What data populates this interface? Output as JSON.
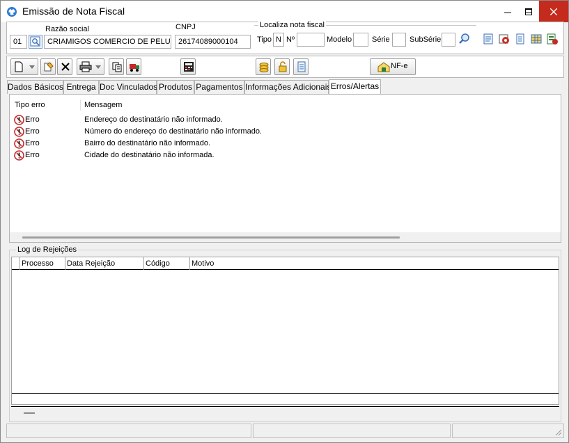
{
  "window": {
    "title": "Emissão de Nota Fiscal",
    "accent": "#c42b1c"
  },
  "header": {
    "razao_label": "Razão social",
    "cnpj_label": "CNPJ",
    "code_value": "01",
    "razao_value": "CRIAMIGOS COMERCIO DE PELUCIA",
    "cnpj_value": "26174089000104",
    "localiza_label": "Localiza nota fiscal",
    "tipo_label": "Tipo",
    "tipo_value": "N",
    "numero_label": "Nº",
    "numero_value": "",
    "modelo_label": "Modelo",
    "modelo_value": "",
    "serie_label": "Série",
    "serie_value": "",
    "subserie_label": "SubSérie",
    "subserie_value": ""
  },
  "toolbar": {
    "nfe_label": "NF-e"
  },
  "tabs": [
    {
      "label": "Dados Básicos"
    },
    {
      "label": "Entrega"
    },
    {
      "label": "Doc Vinculados"
    },
    {
      "label": "Produtos"
    },
    {
      "label": "Pagamentos"
    },
    {
      "label": "Informações Adicionais"
    },
    {
      "label": "Erros/Alertas"
    }
  ],
  "errors": {
    "col_type": "Tipo erro",
    "col_message": "Mensagem",
    "rows": [
      {
        "type": "Erro",
        "message": "Endereço do destinatário não informado."
      },
      {
        "type": "Erro",
        "message": "Número do endereço do destinatário não informado."
      },
      {
        "type": "Erro",
        "message": "Bairro do destinatário não informado."
      },
      {
        "type": "Erro",
        "message": "Cidade do destinatário não informada."
      }
    ]
  },
  "rejections": {
    "title": "Log de Rejeições",
    "columns": [
      "Processo",
      "Data Rejeição",
      "Código",
      "Motivo"
    ]
  }
}
